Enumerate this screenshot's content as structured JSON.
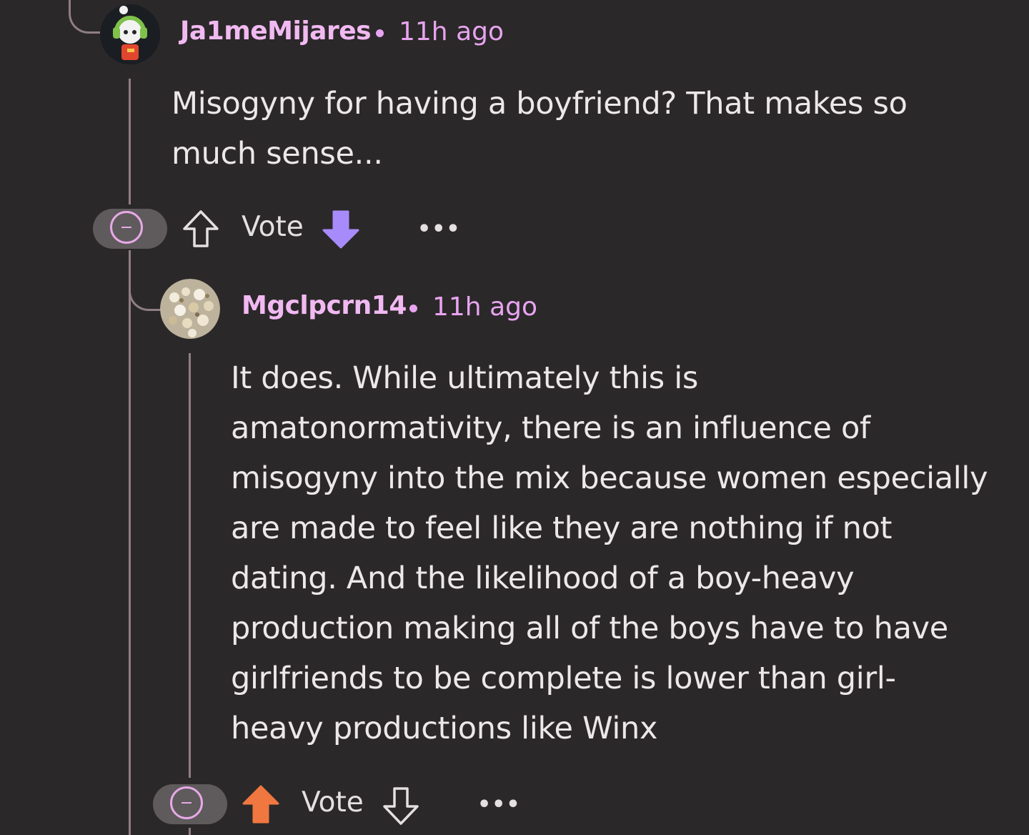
{
  "colors": {
    "background": "#2b2829",
    "thread_line": "#8f7e84",
    "username": "#f1b9f1",
    "timestamp": "#e7a4f0",
    "downvote_active": "#a78bfa",
    "upvote_active": "#f0773f",
    "collapse_pill": "#5f5a5c",
    "collapse_ring": "#e6a9e6"
  },
  "comments": [
    {
      "username": "Ja1meMijares",
      "separator": "•",
      "time": "11h ago",
      "body": "Misogyny for having a boyfriend? That makes so much sense...",
      "vote_label": "Vote",
      "vote_state": "downvoted",
      "avatar_icon": "headphones-avatar-icon",
      "more_label": "•••"
    },
    {
      "username": "Mgclpcrn14",
      "separator": "•",
      "time": "11h ago",
      "body": "It does. While ultimately this is amatonormativity, there is an influence of misogyny into the mix because women especially are made to feel like they are nothing if not dating. And the likelihood of a boy-heavy production making all of the boys have to have girlfriends to be complete is lower than girl-heavy productions like Winx",
      "vote_label": "Vote",
      "vote_state": "upvoted",
      "avatar_icon": "popcorn-avatar-icon",
      "more_label": "•••"
    }
  ]
}
